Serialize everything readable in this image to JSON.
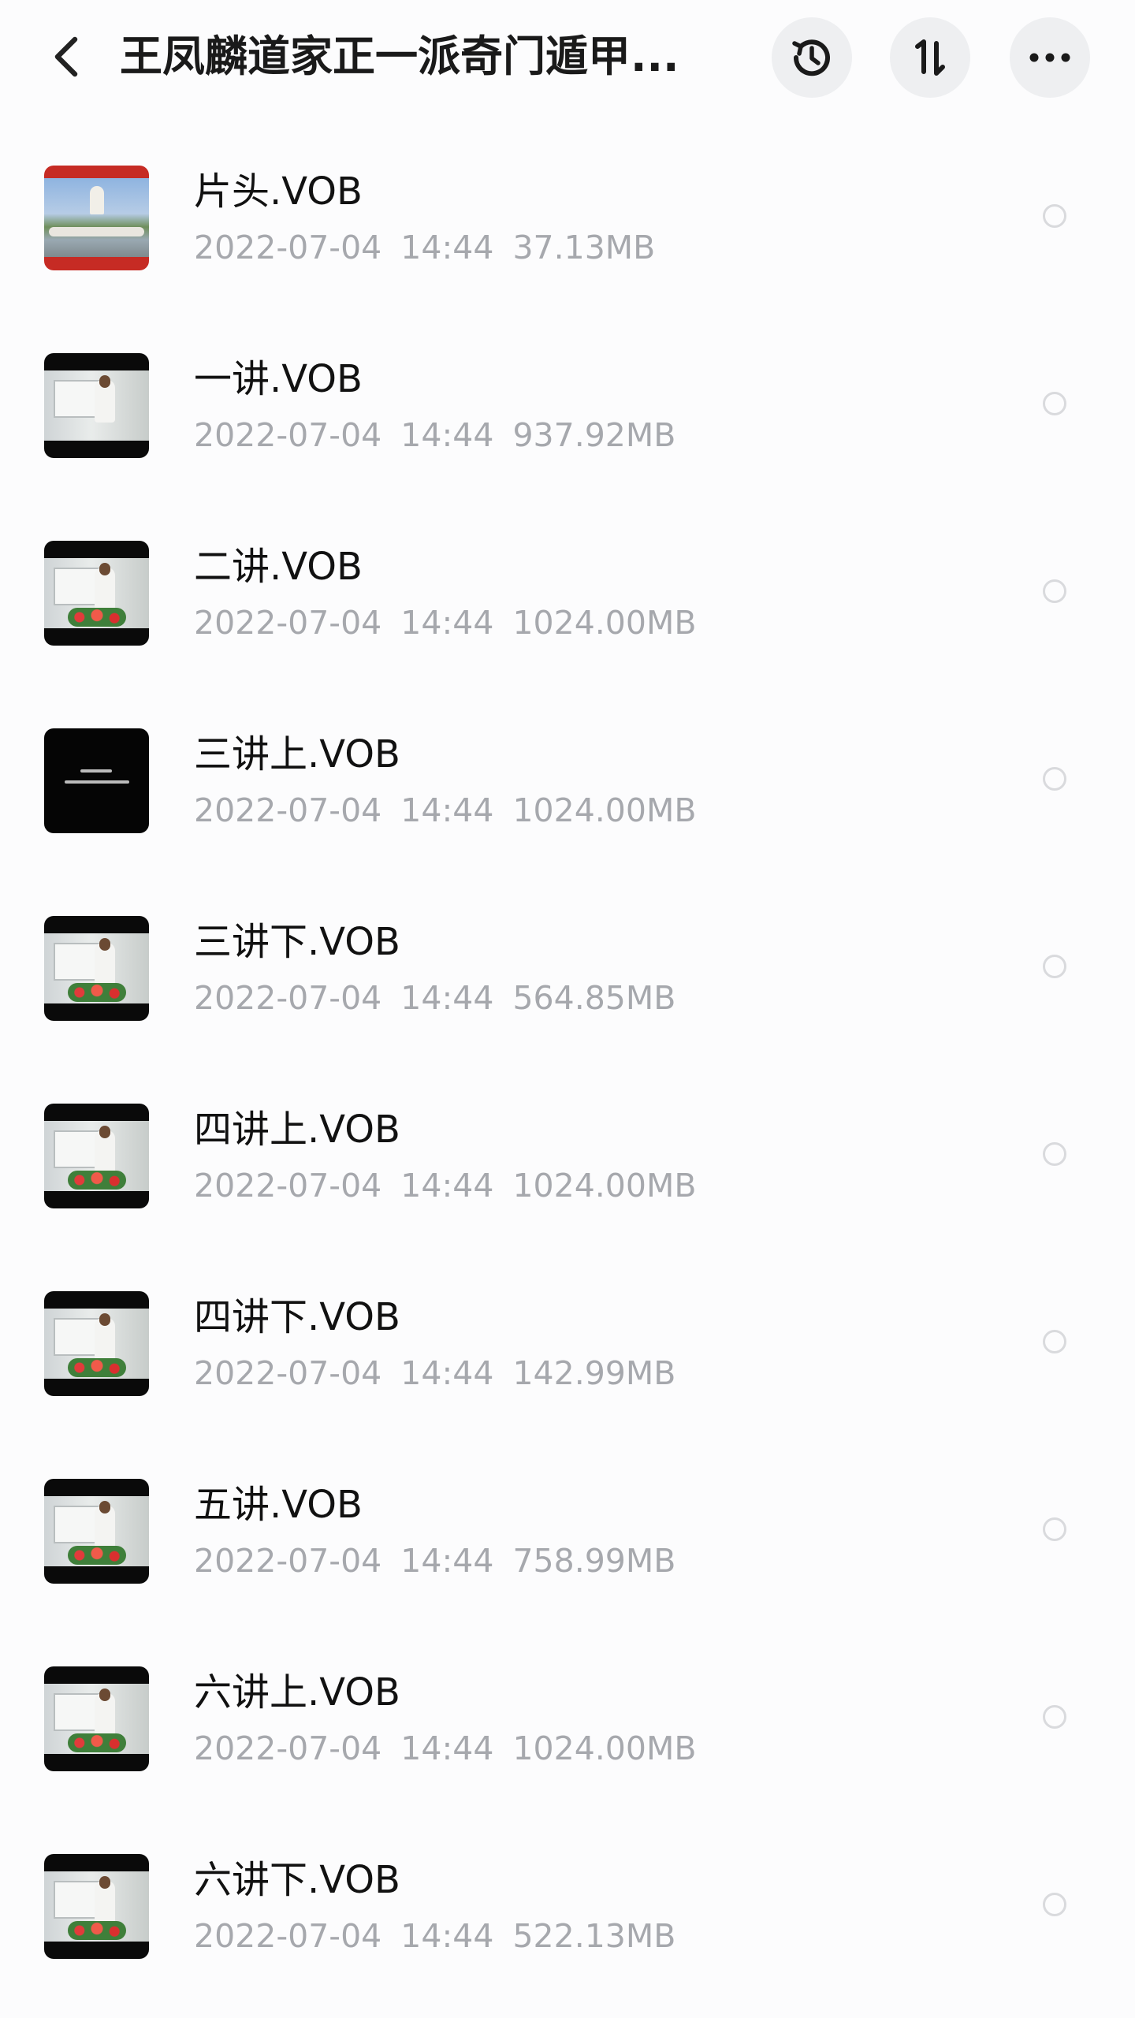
{
  "header": {
    "title": "王凤麟道家正一派奇门遁甲...",
    "icons": {
      "back": "chevron-left-icon",
      "history": "history-clock-icon",
      "sort": "sort-arrows-icon",
      "more": "more-dots-icon"
    }
  },
  "files": [
    {
      "name": "片头.VOB",
      "date": "2022-07-04",
      "time": "14:44",
      "size": "37.13MB",
      "thumb": "landmark"
    },
    {
      "name": "一讲.VOB",
      "date": "2022-07-04",
      "time": "14:44",
      "size": "937.92MB",
      "thumb": "lecture-board"
    },
    {
      "name": "二讲.VOB",
      "date": "2022-07-04",
      "time": "14:44",
      "size": "1024.00MB",
      "thumb": "lecture-flowers"
    },
    {
      "name": "三讲上.VOB",
      "date": "2022-07-04",
      "time": "14:44",
      "size": "1024.00MB",
      "thumb": "black-title"
    },
    {
      "name": "三讲下.VOB",
      "date": "2022-07-04",
      "time": "14:44",
      "size": "564.85MB",
      "thumb": "lecture-flowers"
    },
    {
      "name": "四讲上.VOB",
      "date": "2022-07-04",
      "time": "14:44",
      "size": "1024.00MB",
      "thumb": "lecture-flowers"
    },
    {
      "name": "四讲下.VOB",
      "date": "2022-07-04",
      "time": "14:44",
      "size": "142.99MB",
      "thumb": "lecture-flowers"
    },
    {
      "name": "五讲.VOB",
      "date": "2022-07-04",
      "time": "14:44",
      "size": "758.99MB",
      "thumb": "lecture-flowers"
    },
    {
      "name": "六讲上.VOB",
      "date": "2022-07-04",
      "time": "14:44",
      "size": "1024.00MB",
      "thumb": "lecture-flowers"
    },
    {
      "name": "六讲下.VOB",
      "date": "2022-07-04",
      "time": "14:44",
      "size": "522.13MB",
      "thumb": "lecture-flowers"
    }
  ],
  "colors": {
    "text_primary": "#111111",
    "text_secondary": "#a6a8ad",
    "button_bg": "#eeeff1",
    "radio_border": "#d9dadd",
    "background": "#fcfcfd"
  }
}
